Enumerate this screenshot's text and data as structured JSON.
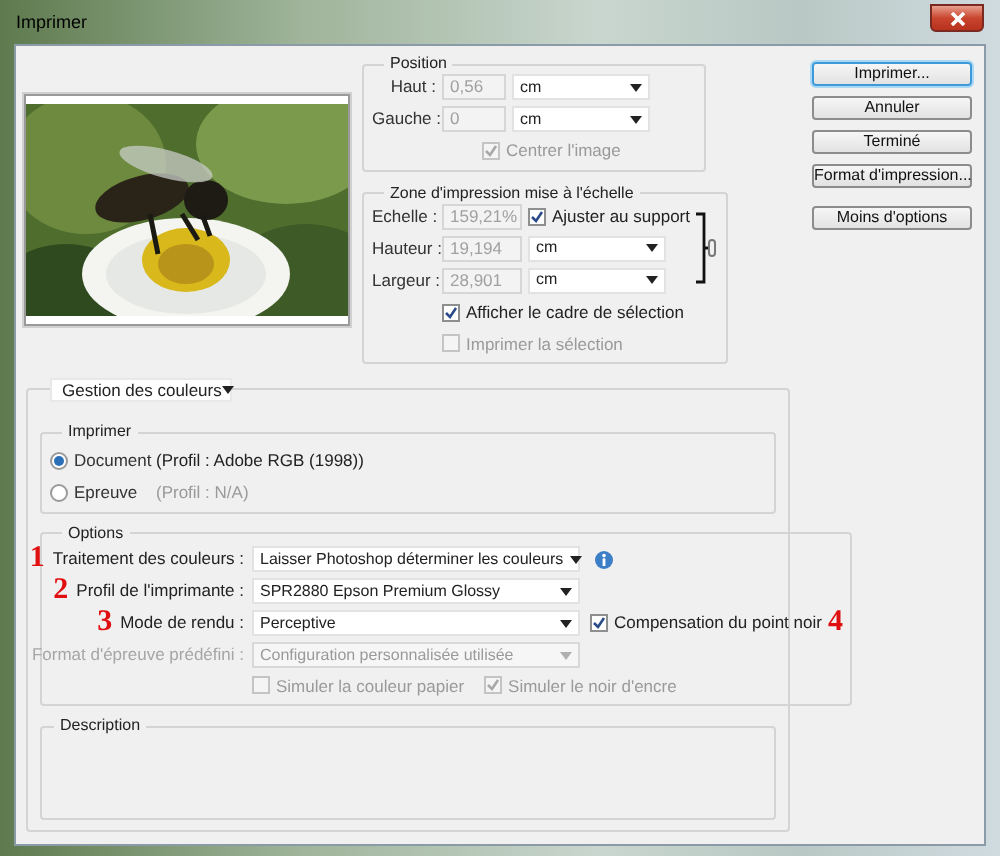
{
  "window": {
    "title": "Imprimer"
  },
  "position": {
    "title": "Position",
    "fields": [
      {
        "label": "Haut :",
        "value": "0,56",
        "unit": "cm"
      },
      {
        "label": "Gauche :",
        "value": "0",
        "unit": "cm"
      }
    ],
    "center": {
      "label": "Centrer l'image",
      "checked": true,
      "disabled": true
    }
  },
  "scaled": {
    "title": "Zone d'impression mise à l'échelle",
    "scale": {
      "label": "Echelle :",
      "value": "159,21%"
    },
    "fit": {
      "label": "Ajuster au support",
      "checked": true,
      "disabled": false
    },
    "fields": [
      {
        "label": "Hauteur :",
        "value": "19,194",
        "unit": "cm"
      },
      {
        "label": "Largeur :",
        "value": "28,901",
        "unit": "cm"
      }
    ],
    "checkboxes": [
      {
        "label": "Afficher le cadre de sélection",
        "checked": true,
        "disabled": false
      },
      {
        "label": "Imprimer la sélection",
        "checked": false,
        "disabled": true
      }
    ]
  },
  "buttons": [
    {
      "label": "Imprimer...",
      "default": true
    },
    {
      "label": "Annuler",
      "default": false
    },
    {
      "label": "Terminé",
      "default": false
    },
    {
      "label": "Format d'impression...",
      "default": false
    },
    {
      "label": "Moins d'options",
      "default": false
    }
  ],
  "color_management": {
    "mode": "Gestion des couleurs",
    "print": {
      "title": "Imprimer",
      "radios": [
        {
          "label": "Document",
          "profile": "(Profil : Adobe RGB (1998))",
          "selected": true
        },
        {
          "label": "Epreuve",
          "profile": "(Profil : N/A)",
          "selected": false
        }
      ]
    },
    "options": {
      "title": "Options",
      "rows": [
        {
          "marker": "1",
          "label": "Traitement des couleurs :",
          "value": "Laisser Photoshop déterminer les couleurs",
          "disabled": false,
          "info": true
        },
        {
          "marker": "2",
          "label": "Profil de l'imprimante :",
          "value": "SPR2880 Epson Premium Glossy",
          "disabled": false
        },
        {
          "marker": "3",
          "label": "Mode de rendu :",
          "value": "Perceptive",
          "disabled": false,
          "checkbox": {
            "label": "Compensation du point noir",
            "checked": true,
            "disabled": false
          },
          "marker_after": "4"
        },
        {
          "label": "Format d'épreuve prédéfini :",
          "value": "Configuration personnalisée utilisée",
          "disabled": true
        }
      ],
      "checkboxes": [
        {
          "label": "Simuler la couleur papier",
          "checked": false,
          "disabled": true
        },
        {
          "label": "Simuler le noir d'encre",
          "checked": true,
          "disabled": true
        }
      ]
    },
    "description": {
      "title": "Description"
    }
  }
}
